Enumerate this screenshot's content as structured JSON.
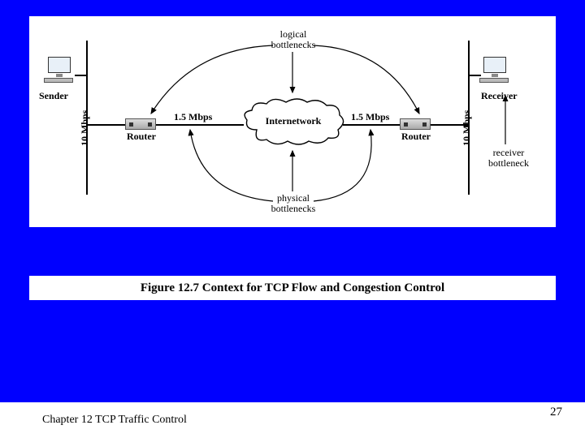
{
  "diagram": {
    "sender_label": "Sender",
    "receiver_label": "Receiver",
    "router_label_left": "Router",
    "router_label_right": "Router",
    "link_speed_lan_left": "10 Mbps",
    "link_speed_lan_right": "10 Mbps",
    "link_speed_wan_left": "1.5 Mbps",
    "link_speed_wan_right": "1.5 Mbps",
    "center_label": "Internetwork",
    "top_annotation": "logical\nbottlenecks",
    "bottom_annotation": "physical\nbottlenecks",
    "right_annotation": "receiver\nbottleneck"
  },
  "caption": "Figure 12.7   Context for TCP Flow and Congestion Control",
  "footer": "Chapter 12 TCP Traffic Control",
  "page_number": "27"
}
